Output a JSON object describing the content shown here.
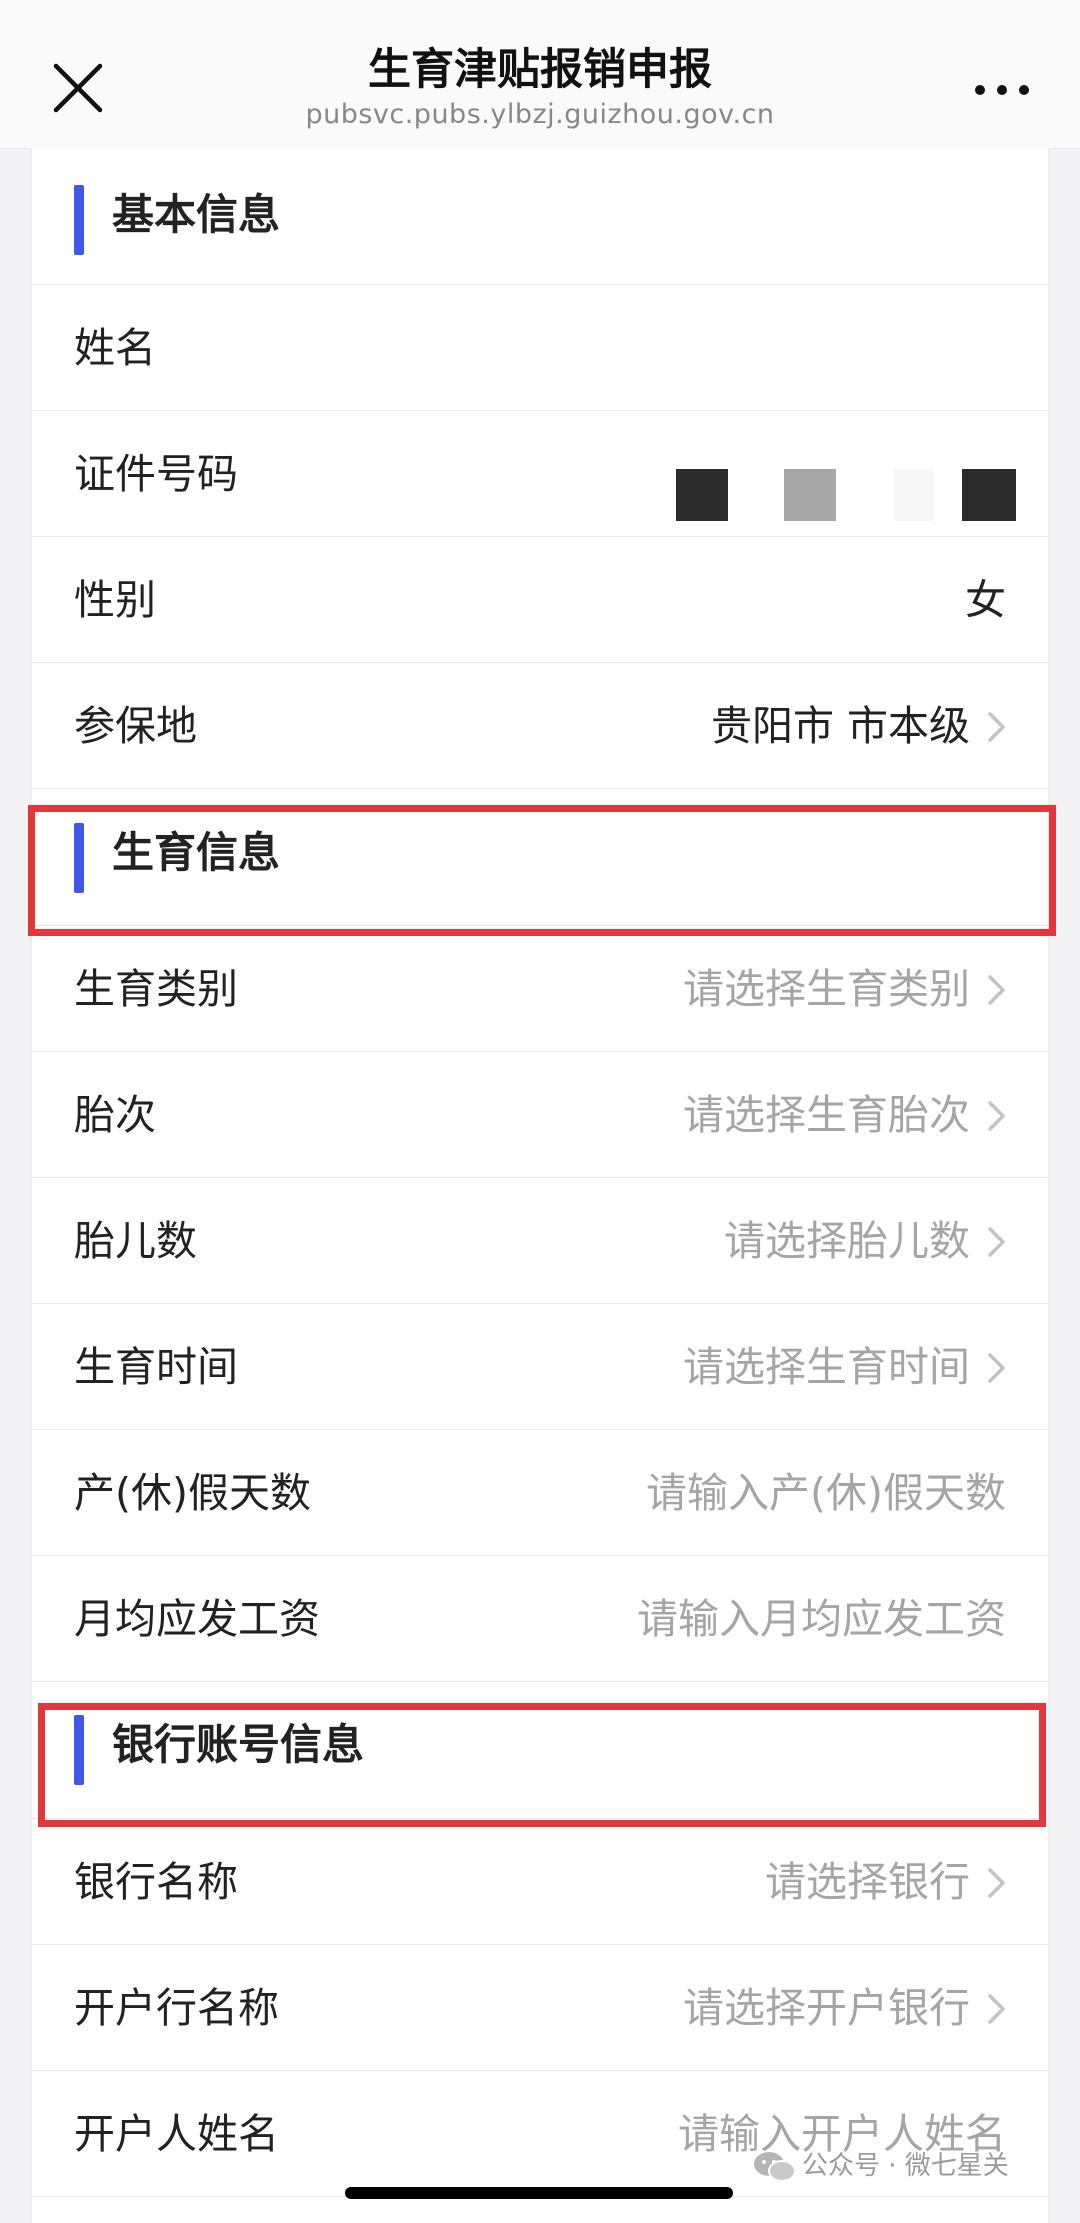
{
  "header": {
    "title": "生育津贴报销申报",
    "url": "pubsvc.pubs.ylbzj.guizhou.gov.cn",
    "close_icon": "close-icon",
    "more_icon": "more-icon"
  },
  "sections": {
    "basic": {
      "title": "基本信息",
      "name_label": "姓名",
      "id_label": "证件号码",
      "gender_label": "性别",
      "gender_value": "女",
      "insured_label": "参保地",
      "insured_value": "贵阳市 市本级"
    },
    "birth": {
      "title": "生育信息",
      "type_label": "生育类别",
      "type_placeholder": "请选择生育类别",
      "order_label": "胎次",
      "order_placeholder": "请选择生育胎次",
      "count_label": "胎儿数",
      "count_placeholder": "请选择胎儿数",
      "time_label": "生育时间",
      "time_placeholder": "请选择生育时间",
      "leave_label": "产(休)假天数",
      "leave_placeholder": "请输入产(休)假天数",
      "wage_label": "月均应发工资",
      "wage_placeholder": "请输入月均应发工资"
    },
    "bank": {
      "title": "银行账号信息",
      "bank_label": "银行名称",
      "bank_placeholder": "请选择银行",
      "branch_label": "开户行名称",
      "branch_placeholder": "请选择开户银行",
      "holder_label": "开户人姓名",
      "holder_placeholder": "请输入开户人姓名"
    }
  },
  "colors": {
    "accent": "#3e59ea",
    "highlight": "#e3383b",
    "placeholder": "#a5a5a5"
  },
  "watermark": {
    "text": "公众号 · 微七星关",
    "icon": "wechat-icon"
  }
}
